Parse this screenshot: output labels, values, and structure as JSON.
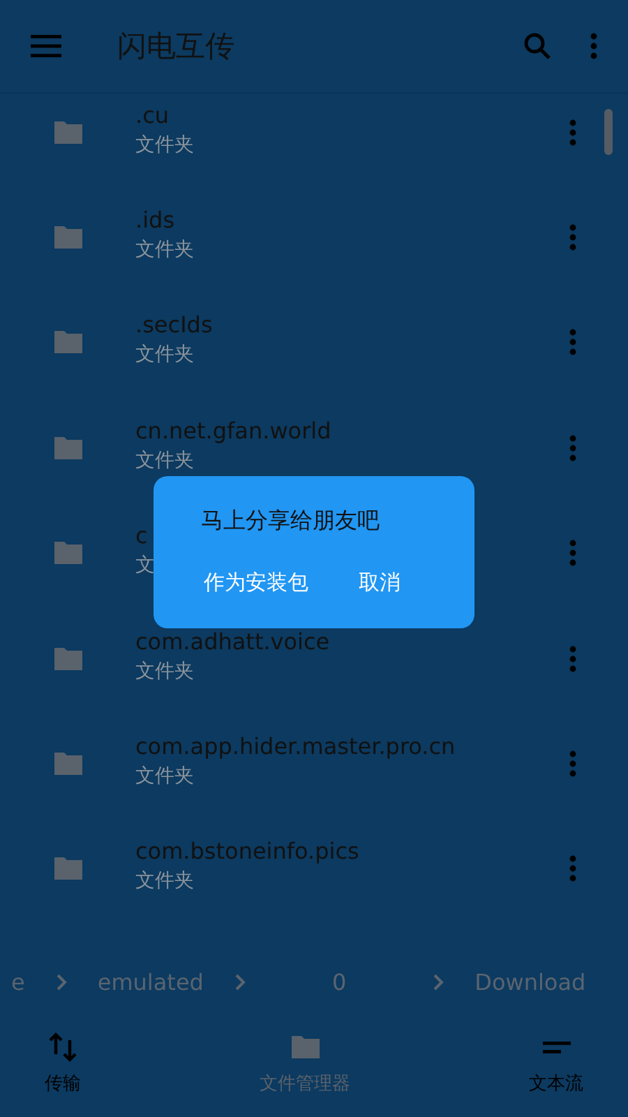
{
  "app_bar": {
    "title": "闪电互传"
  },
  "files": [
    {
      "name": ".cu",
      "type": "文件夹"
    },
    {
      "name": ".ids",
      "type": "文件夹"
    },
    {
      "name": ".secIds",
      "type": "文件夹"
    },
    {
      "name": "cn.net.gfan.world",
      "type": "文件夹"
    },
    {
      "name": "c",
      "type": "文"
    },
    {
      "name": "com.adhatt.voice",
      "type": "文件夹"
    },
    {
      "name": "com.app.hider.master.pro.cn",
      "type": "文件夹"
    },
    {
      "name": "com.bstoneinfo.pics",
      "type": "文件夹"
    }
  ],
  "breadcrumb": [
    "e",
    "emulated",
    "0",
    "Download"
  ],
  "bottom_nav": [
    {
      "label": "传输",
      "selected": false
    },
    {
      "label": "文件管理器",
      "selected": true
    },
    {
      "label": "文本流",
      "selected": false
    }
  ],
  "dialog": {
    "message": "马上分享给朋友吧",
    "buttons": [
      "作为安装包",
      "取消"
    ]
  }
}
